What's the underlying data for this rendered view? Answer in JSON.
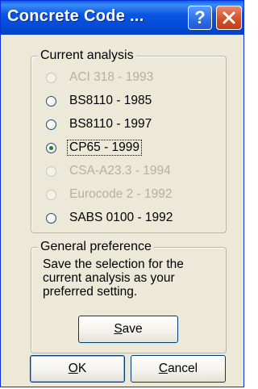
{
  "window": {
    "title": "Concrete Code ...",
    "help_button": "?",
    "close_button": "close"
  },
  "analysis": {
    "legend": "Current analysis",
    "options": [
      {
        "label": "ACI 318 - 1993",
        "enabled": false,
        "selected": false
      },
      {
        "label": "BS8110 - 1985",
        "enabled": true,
        "selected": false
      },
      {
        "label": "BS8110 - 1997",
        "enabled": true,
        "selected": false
      },
      {
        "label": "CP65 - 1999",
        "enabled": true,
        "selected": true
      },
      {
        "label": "CSA-A23.3 - 1994",
        "enabled": false,
        "selected": false
      },
      {
        "label": "Eurocode 2 - 1992",
        "enabled": false,
        "selected": false
      },
      {
        "label": "SABS 0100 - 1992",
        "enabled": true,
        "selected": false
      }
    ]
  },
  "preference": {
    "legend": "General preference",
    "description": "Save the selection for the current analysis as your preferred setting.",
    "save_label_mnemonic": "S",
    "save_label_rest": "ave"
  },
  "footer": {
    "ok_mnemonic": "O",
    "ok_rest": "K",
    "cancel_mnemonic": "C",
    "cancel_rest": "ancel"
  },
  "colors": {
    "titlebar": "#0a56e2",
    "dialog_bg": "#ece9d8",
    "disabled_text": "#b3b1a3",
    "close_button": "#d3502b"
  }
}
